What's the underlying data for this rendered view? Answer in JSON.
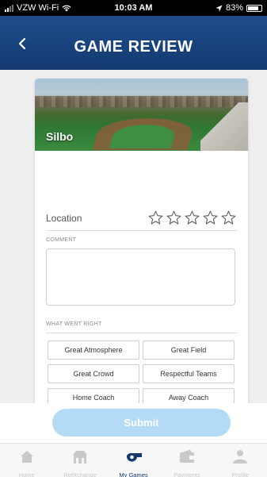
{
  "status_bar": {
    "carrier": "VZW Wi-Fi",
    "time": "10:03 AM",
    "battery": "83%",
    "battery_level": 0.83
  },
  "header": {
    "title": "GAME REVIEW",
    "back_icon": "chevron-left-icon"
  },
  "card": {
    "field_name": "Silbo",
    "location_label": "Location",
    "location_rating": 0,
    "max_rating": 5,
    "comment_label": "COMMENT",
    "comment_value": "",
    "went_right_label": "WHAT WENT RIGHT",
    "chips": [
      "Great Atmosphere",
      "Great Field",
      "Great Crowd",
      "Respectful Teams",
      "Home Coach",
      "Away Coach"
    ]
  },
  "submit_label": "Submit",
  "tabs": [
    {
      "label": "Home",
      "icon": "home-icon",
      "active": false
    },
    {
      "label": "RefXchange",
      "icon": "refxchange-icon",
      "active": false
    },
    {
      "label": "My Games",
      "icon": "whistle-icon",
      "active": true
    },
    {
      "label": "Payments",
      "icon": "wallet-icon",
      "active": false
    },
    {
      "label": "Profile",
      "icon": "profile-icon",
      "active": false
    }
  ],
  "colors": {
    "header": "#1a4480",
    "submit_disabled": "#b3dbf5",
    "active_tab": "#143a70",
    "inactive_tab": "#c9c9c9"
  }
}
